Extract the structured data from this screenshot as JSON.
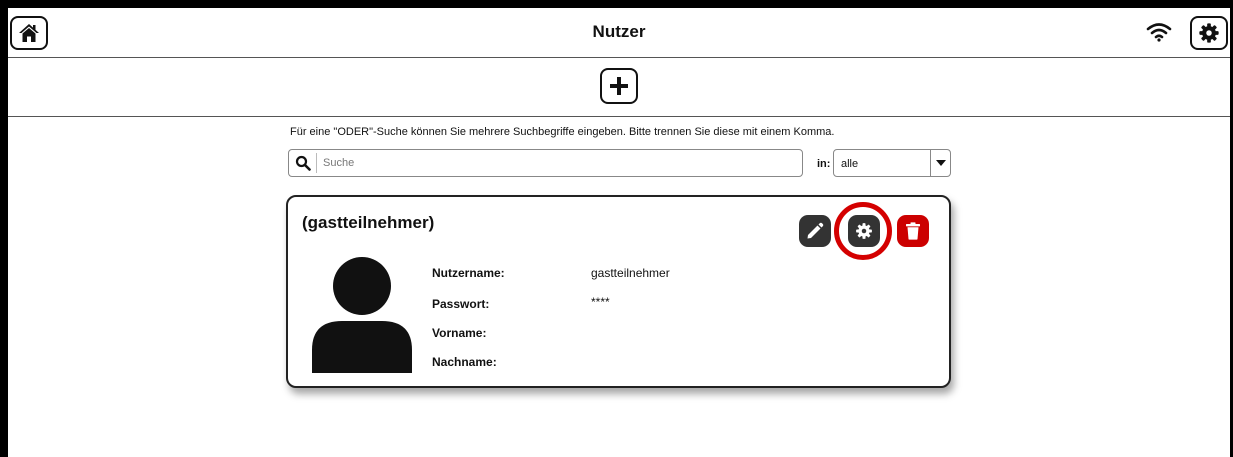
{
  "header": {
    "title": "Nutzer",
    "home_icon": "home-icon",
    "wifi_icon": "wifi-icon",
    "settings_icon": "gear-icon"
  },
  "toolbar": {
    "add_icon": "plus-icon"
  },
  "search": {
    "hint": "Für eine \"ODER\"-Suche können Sie mehrere Suchbegriffe eingeben. Bitte trennen Sie diese mit einem Komma.",
    "placeholder": "Suche",
    "value": "",
    "in_label": "in:",
    "scope_selected": "alle"
  },
  "user_card": {
    "title": "(gastteilnehmer)",
    "fields": [
      {
        "label": "Nutzername:",
        "value": "gastteilnehmer"
      },
      {
        "label": "Passwort:",
        "value": "****"
      },
      {
        "label": "Vorname:",
        "value": ""
      },
      {
        "label": "Nachname:",
        "value": ""
      }
    ],
    "actions": [
      "edit",
      "settings",
      "delete"
    ],
    "delete_color": "#cc0000",
    "highlight_color": "#d40000"
  }
}
